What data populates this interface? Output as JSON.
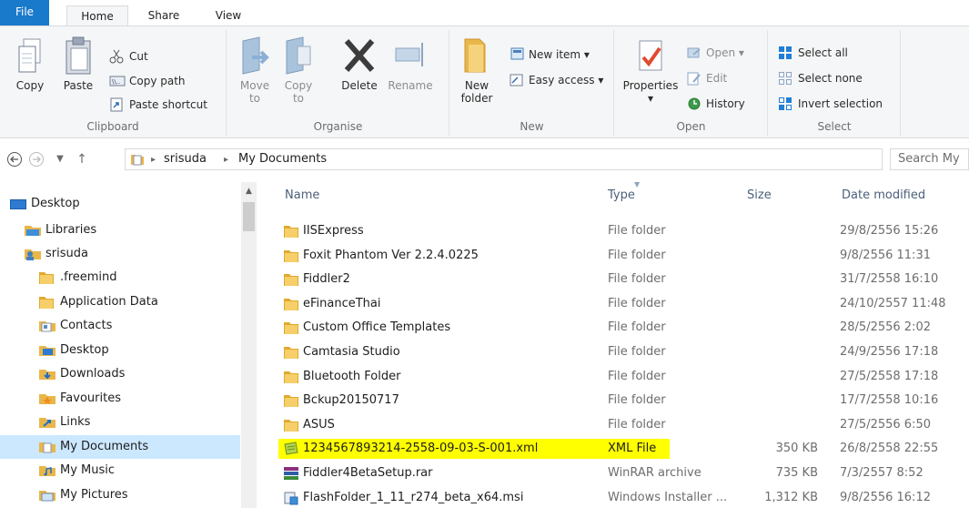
{
  "ribbon": {
    "tabs": {
      "file": "File",
      "home": "Home",
      "share": "Share",
      "view": "View"
    },
    "clipboard": {
      "label": "Clipboard",
      "copy": "Copy",
      "paste": "Paste",
      "cut": "Cut",
      "copy_path": "Copy path",
      "paste_shortcut": "Paste shortcut"
    },
    "organise": {
      "label": "Organise",
      "move_to": "Move to",
      "copy_to": "Copy to",
      "delete": "Delete",
      "rename": "Rename"
    },
    "new": {
      "label": "New",
      "new_folder": "New folder",
      "new_item": "New item",
      "easy_access": "Easy access"
    },
    "open": {
      "label": "Open",
      "properties": "Properties",
      "open": "Open",
      "edit": "Edit",
      "history": "History"
    },
    "select": {
      "label": "Select",
      "select_all": "Select all",
      "select_none": "Select none",
      "invert_selection": "Invert selection"
    }
  },
  "address": {
    "crumbs": [
      "srisuda",
      "My Documents"
    ],
    "search_placeholder": "Search My"
  },
  "nav": {
    "items": [
      {
        "label": "Desktop",
        "icon": "desktop-icon"
      },
      {
        "label": "Libraries",
        "icon": "libraries-icon"
      },
      {
        "label": "srisuda",
        "icon": "user-icon"
      },
      {
        "label": ".freemind",
        "icon": "folder-icon"
      },
      {
        "label": "Application Data",
        "icon": "folder-icon"
      },
      {
        "label": "Contacts",
        "icon": "contacts-icon"
      },
      {
        "label": "Desktop",
        "icon": "desktop-folder-icon"
      },
      {
        "label": "Downloads",
        "icon": "downloads-icon"
      },
      {
        "label": "Favourites",
        "icon": "favourites-icon"
      },
      {
        "label": "Links",
        "icon": "links-icon"
      },
      {
        "label": "My Documents",
        "icon": "documents-icon"
      },
      {
        "label": "My Music",
        "icon": "music-icon"
      },
      {
        "label": "My Pictures",
        "icon": "pictures-icon"
      }
    ]
  },
  "columns": {
    "name": "Name",
    "type": "Type",
    "size": "Size",
    "date": "Date modified"
  },
  "files": [
    {
      "name": "IISExpress",
      "type": "File folder",
      "size": "",
      "date": "29/8/2556 15:26",
      "icon": "folder-icon"
    },
    {
      "name": "Foxit Phantom Ver 2.2.4.0225",
      "type": "File folder",
      "size": "",
      "date": "9/8/2556 11:31",
      "icon": "folder-icon"
    },
    {
      "name": "Fiddler2",
      "type": "File folder",
      "size": "",
      "date": "31/7/2558 16:10",
      "icon": "folder-icon"
    },
    {
      "name": "eFinanceThai",
      "type": "File folder",
      "size": "",
      "date": "24/10/2557 11:48",
      "icon": "folder-icon"
    },
    {
      "name": "Custom Office Templates",
      "type": "File folder",
      "size": "",
      "date": "28/5/2556 2:02",
      "icon": "folder-icon"
    },
    {
      "name": "Camtasia Studio",
      "type": "File folder",
      "size": "",
      "date": "24/9/2556 17:18",
      "icon": "folder-icon"
    },
    {
      "name": "Bluetooth Folder",
      "type": "File folder",
      "size": "",
      "date": "27/5/2558 17:18",
      "icon": "folder-icon"
    },
    {
      "name": "Bckup20150717",
      "type": "File folder",
      "size": "",
      "date": "17/7/2558 10:16",
      "icon": "folder-icon"
    },
    {
      "name": "ASUS",
      "type": "File folder",
      "size": "",
      "date": "27/5/2556 6:50",
      "icon": "folder-icon"
    },
    {
      "name": "1234567893214-2558-09-03-S-001.xml",
      "type": "XML File",
      "size": "350 KB",
      "date": "26/8/2558 22:55",
      "icon": "xml-file-icon"
    },
    {
      "name": "Fiddler4BetaSetup.rar",
      "type": "WinRAR archive",
      "size": "735 KB",
      "date": "7/3/2557 8:52",
      "icon": "rar-file-icon"
    },
    {
      "name": "FlashFolder_1_11_r274_beta_x64.msi",
      "type": "Windows Installer ...",
      "size": "1,312 KB",
      "date": "9/8/2556 16:12",
      "icon": "msi-file-icon"
    }
  ],
  "colors": {
    "file_tab": "#1979ca",
    "selection": "#cce8ff",
    "highlight": "#ffff00",
    "folder": "#f2c55c"
  }
}
